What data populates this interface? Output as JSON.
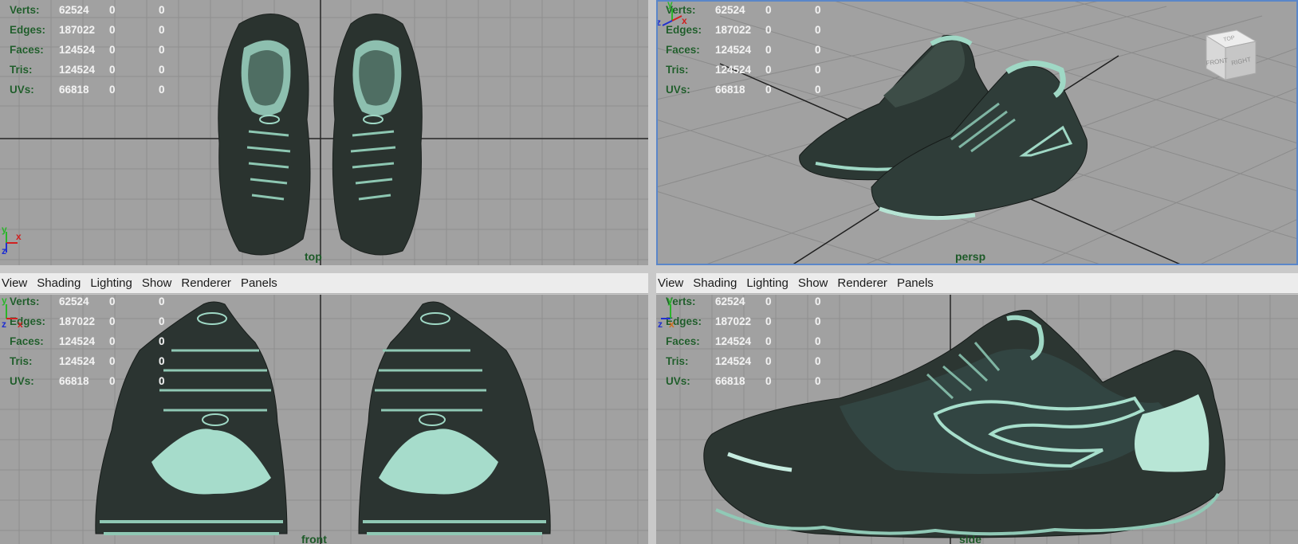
{
  "menu": [
    "View",
    "Shading",
    "Lighting",
    "Show",
    "Renderer",
    "Panels"
  ],
  "hud_stats": [
    {
      "label": "Verts:",
      "v1": "62524",
      "v2": "0",
      "v3": "0"
    },
    {
      "label": "Edges:",
      "v1": "187022",
      "v2": "0",
      "v3": "0"
    },
    {
      "label": "Faces:",
      "v1": "124524",
      "v2": "0",
      "v3": "0"
    },
    {
      "label": "Tris:",
      "v1": "124524",
      "v2": "0",
      "v3": "0"
    },
    {
      "label": "UVs:",
      "v1": "66818",
      "v2": "0",
      "v3": "0"
    }
  ],
  "panels": {
    "top": {
      "camera": "top",
      "axes": [
        "y",
        "x",
        "z"
      ]
    },
    "persp": {
      "camera": "persp",
      "axes": [
        "y",
        "z",
        "x"
      ]
    },
    "front": {
      "camera": "front",
      "axes": [
        "y",
        "z",
        "x"
      ]
    },
    "side": {
      "camera": "side",
      "axes": [
        "y",
        "z",
        "x"
      ]
    }
  },
  "view_cube": {
    "top": "TOP",
    "front": "FRONT",
    "right": "RIGHT"
  },
  "colors": {
    "viewport_bg": "#a1a1a1",
    "grid": "#8b8b8b",
    "axis_line": "#202020",
    "hud_label": "#1f5c2a",
    "active_border": "#5a86c9",
    "shoe_dark": "#2a332f",
    "shoe_accent": "#9fd8c5"
  }
}
